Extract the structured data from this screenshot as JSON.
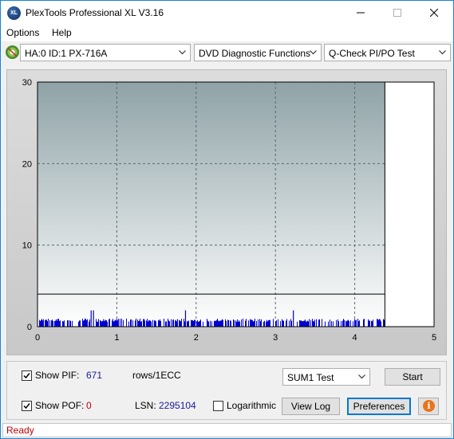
{
  "window": {
    "title": "PlexTools Professional XL V3.16",
    "app_icon_text": "XL"
  },
  "menu": {
    "options": "Options",
    "help": "Help"
  },
  "toolbar": {
    "drive": "HA:0 ID:1  PX-716A",
    "function": "DVD Diagnostic Functions",
    "test": "Q-Check PI/PO Test"
  },
  "chart_data": {
    "type": "bar",
    "xlim": [
      0,
      5
    ],
    "ylim": [
      0,
      30
    ],
    "xticks": [
      "0",
      "1",
      "2",
      "3",
      "4",
      "5"
    ],
    "yticks": [
      "0",
      "10",
      "20",
      "30"
    ],
    "threshold": 4,
    "data_end_x": 4.38,
    "grid": true,
    "background_upper": "#8fa3a7",
    "background_lower": "#ffffff",
    "bar_color": "#0000d0",
    "spikes": [
      {
        "x": 0.67,
        "y": 2
      },
      {
        "x": 0.7,
        "y": 2
      },
      {
        "x": 1.86,
        "y": 2
      },
      {
        "x": 3.22,
        "y": 2
      }
    ],
    "baseline_height": 1
  },
  "controls": {
    "show_pif_label": "Show PIF:",
    "pif_value": "671",
    "rows_label": "rows/1ECC",
    "show_pof_label": "Show POF:",
    "pof_value": "0",
    "lsn_label": "LSN:",
    "lsn_value": "2295104",
    "logarithmic_label": "Logarithmic",
    "sum_test": "SUM1 Test",
    "start_button": "Start",
    "view_log_button": "View Log",
    "preferences_button": "Preferences",
    "info_icon_text": "i"
  },
  "status": {
    "text": "Ready"
  }
}
